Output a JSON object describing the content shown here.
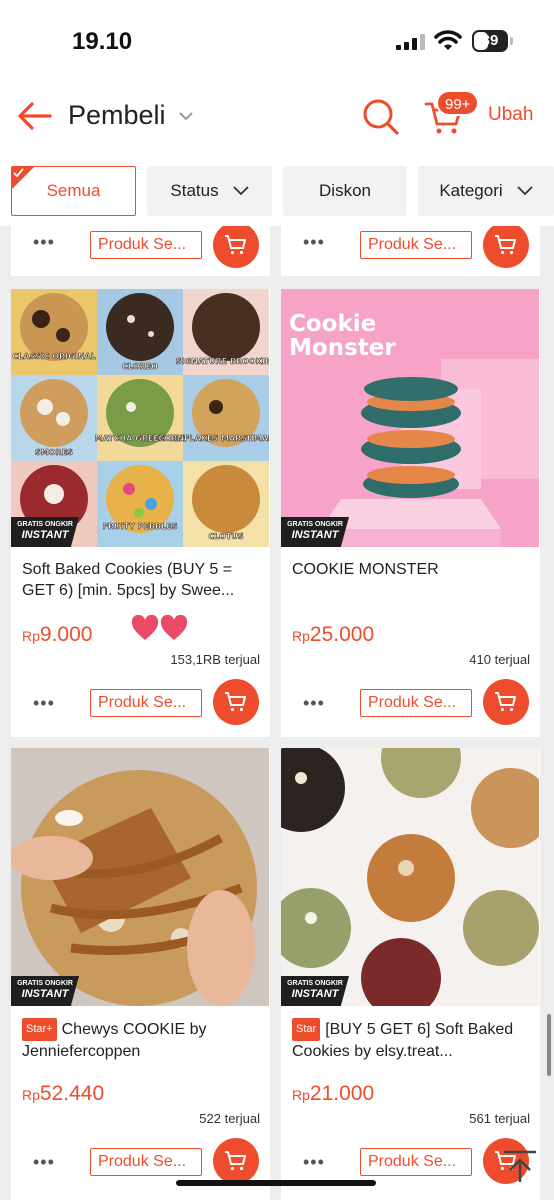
{
  "status": {
    "time": "19.10",
    "battery": "39"
  },
  "nav": {
    "title": "Pembeli",
    "cart_badge": "99+",
    "edit": "Ubah"
  },
  "filters": [
    {
      "label": "Semua"
    },
    {
      "label": "Status"
    },
    {
      "label": "Diskon"
    },
    {
      "label": "Kategori"
    }
  ],
  "actions": {
    "similar": "Produk Se...",
    "shipping_line1": "GRATIS ONGKIR",
    "shipping_line2": "INSTANT"
  },
  "products": [
    {
      "title": "Soft Baked Cookies (BUY 5 = GET 6) [min. 5pcs] by Swee...",
      "currency": "Rp",
      "price": "9.000",
      "sold": "153,1RB terjual",
      "cookie_labels": [
        "CLASSIC ORIGINAL",
        "CLOREO",
        "SIGNATURE BROOKIES",
        "SMORES",
        "MATCHA GREEN TEA",
        "CORNFLAKES MARSHMALLOW",
        "FRUITY PEBBLES",
        "CLOTUS"
      ]
    },
    {
      "title": "COOKIE MONSTER",
      "currency": "Rp",
      "price": "25.000",
      "sold": "410 terjual",
      "image_text": "Cookie Monster"
    },
    {
      "badge": "Star+",
      "title": "Chewys COOKIE by Jenniefercoppen",
      "currency": "Rp",
      "price": "52.440",
      "sold": "522 terjual"
    },
    {
      "badge": "Star",
      "title": "[BUY 5 GET 6] Soft Baked Cookies by elsy.treat...",
      "currency": "Rp",
      "price": "21.000",
      "sold": "561 terjual"
    }
  ],
  "colors": {
    "accent": "#ee4d2d",
    "background": "#ededed"
  }
}
